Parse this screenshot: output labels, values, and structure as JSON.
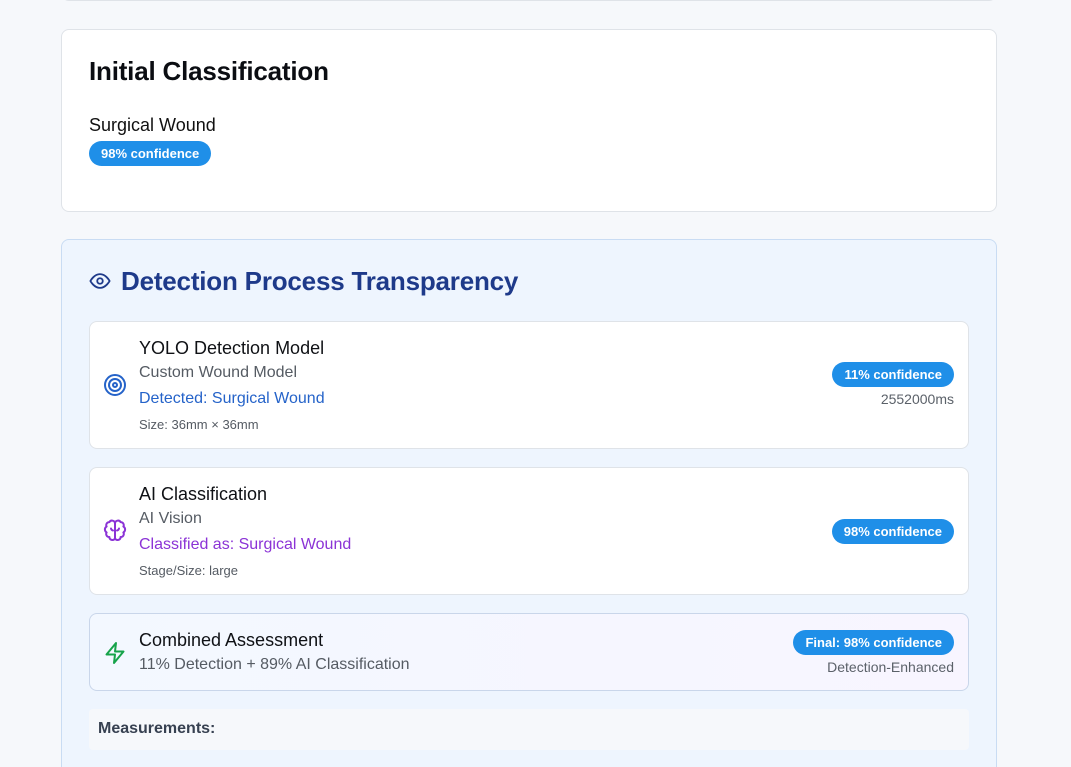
{
  "initial": {
    "title": "Initial Classification",
    "label": "Surgical Wound",
    "confidence": "98% confidence"
  },
  "transparency": {
    "title": "Detection Process Transparency",
    "icon": "eye-icon",
    "steps": [
      {
        "icon": "target-icon",
        "title": "YOLO Detection Model",
        "subtitle": "Custom Wound Model",
        "result": "Detected: Surgical Wound",
        "meta": "Size: 36mm × 36mm",
        "confidence": "11% confidence",
        "note": "2552000ms"
      },
      {
        "icon": "brain-icon",
        "title": "AI Classification",
        "subtitle": "AI Vision",
        "result": "Classified as: Surgical Wound",
        "meta": "Stage/Size: large",
        "confidence": "98% confidence"
      },
      {
        "icon": "lightning-icon",
        "title": "Combined Assessment",
        "subtitle": "11% Detection + 89% AI Classification",
        "confidence": "Final: 98% confidence",
        "note": "Detection-Enhanced"
      }
    ],
    "measurements_label": "Measurements:"
  },
  "colors": {
    "badge": "#1f8fe8",
    "heading_blue": "#1e3a8a",
    "detected_blue": "#2563c9",
    "classified_purple": "#8b33d6",
    "lightning_green": "#16a34a"
  }
}
